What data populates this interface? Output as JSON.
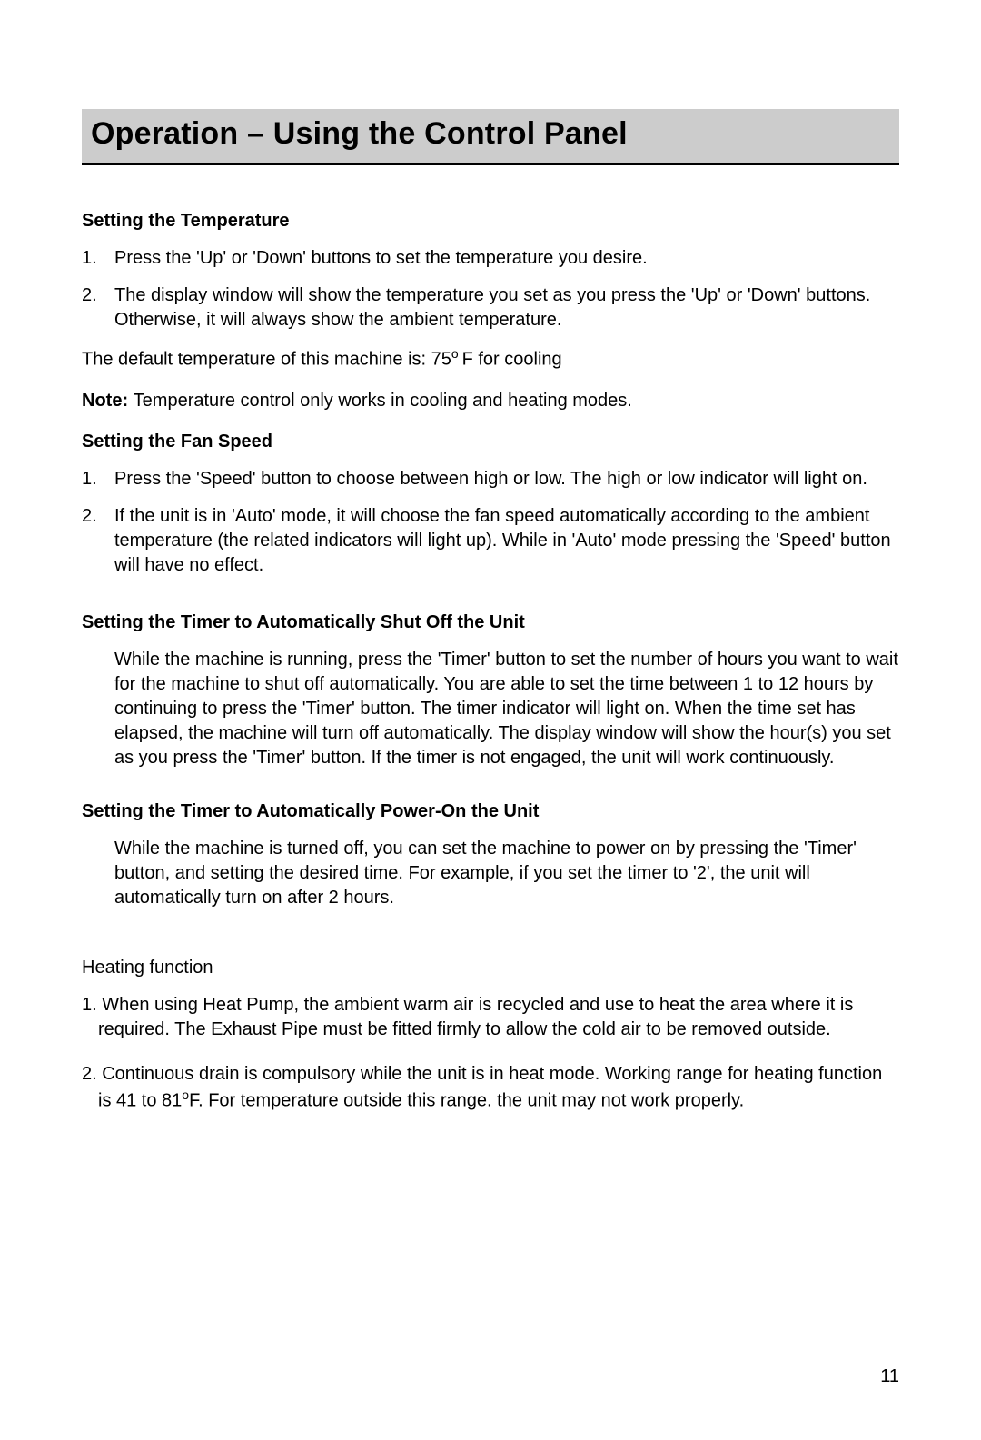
{
  "title": "Operation – Using the Control Panel",
  "sections": {
    "temp": {
      "heading": "Setting the Temperature",
      "items": [
        "Press the 'Up' or 'Down' buttons to set the temperature you desire.",
        "The display window will show the temperature you set as you press the 'Up' or 'Down' buttons.  Otherwise, it will always show the ambient temperature."
      ],
      "default_line_prefix": "The default temperature of this machine is:  75",
      "default_line_suffix": "F for cooling",
      "degree_mark": "o ",
      "note_label": "Note: ",
      "note_text": "Temperature control only works in cooling and heating modes."
    },
    "fan": {
      "heading": "Setting the Fan Speed",
      "items": [
        "Press the 'Speed' button to choose between high or low. The high or low indicator will light on.",
        "If the unit is in 'Auto' mode, it will choose the fan speed automatically according to the ambient temperature (the related indicators will light up). While in 'Auto' mode pressing the 'Speed' button will have no effect."
      ]
    },
    "timer_off": {
      "heading": "Setting the Timer to Automatically Shut Off the Unit",
      "body": "While the machine is running, press the 'Timer' button to set the number of hours you want to wait for the machine to shut off automatically. You are able to set the time between 1 to 12 hours by continuing to press the 'Timer' button. The timer indicator will light on. When the time set has elapsed, the machine will turn off automatically. The display window will show the hour(s) you set as you press the 'Timer' button. If the timer is not engaged, the unit will work continuously."
    },
    "timer_on": {
      "heading": "Setting the Timer to Automatically Power-On the Unit",
      "body": "While the machine is turned off, you can set the machine to power on by pressing the 'Timer' button, and setting the desired time. For example, if you set the timer to '2', the unit will automatically turn on after 2 hours."
    },
    "heating": {
      "heading": "Heating function",
      "item1": "1. When using Heat Pump, the ambient warm air is recycled and use to heat the area where it is required. The Exhaust Pipe must be fitted firmly to allow the cold air to be removed outside.",
      "item2_prefix": "2. Continuous drain is compulsory while the unit is in heat mode. Working range for heating function is 41 to 81",
      "item2_degree": "o",
      "item2_suffix": "F. For temperature outside this range. the unit may not work properly."
    }
  },
  "page_number": "11"
}
